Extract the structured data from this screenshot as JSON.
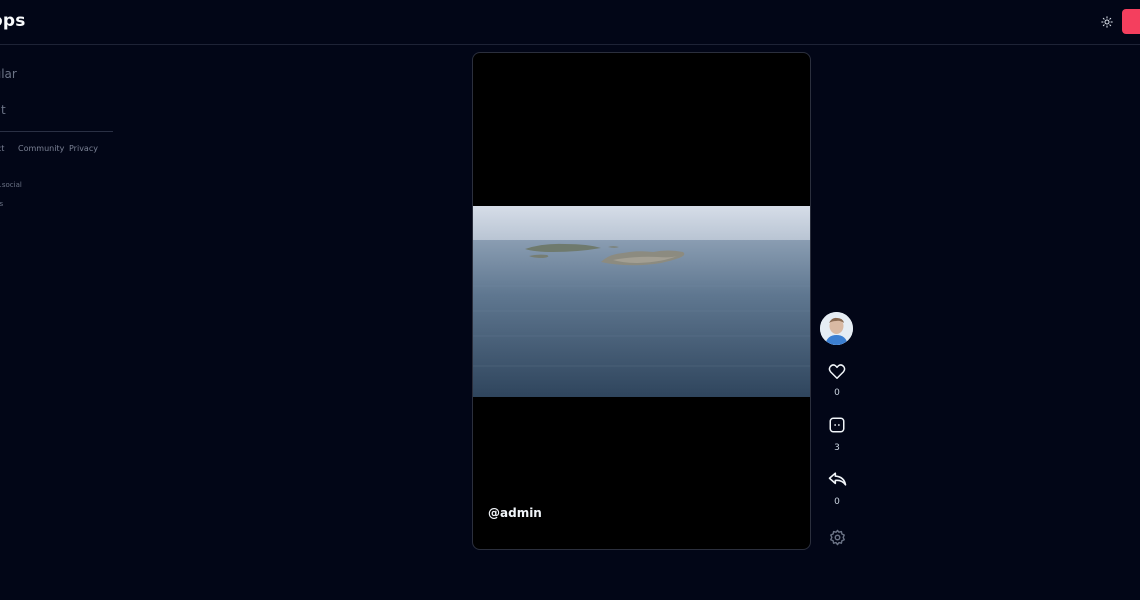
{
  "header": {
    "brand": "ops",
    "theme_toggle_icon": "sun-icon",
    "accent_color": "#f43f5e"
  },
  "sidebar": {
    "items": [
      {
        "label": "pular"
      },
      {
        "label": "out"
      }
    ],
    "footer_links": [
      {
        "label": "act"
      },
      {
        "label": "Community"
      },
      {
        "label": "Privacy"
      }
    ],
    "domain_text": "s.social",
    "tagline": "ps"
  },
  "video": {
    "author": "@admin"
  },
  "actions": {
    "like_count": "0",
    "comment_count": "3",
    "share_count": "0",
    "icons": [
      "avatar",
      "heart-icon",
      "comment-icon",
      "share-icon",
      "gear-icon"
    ]
  }
}
